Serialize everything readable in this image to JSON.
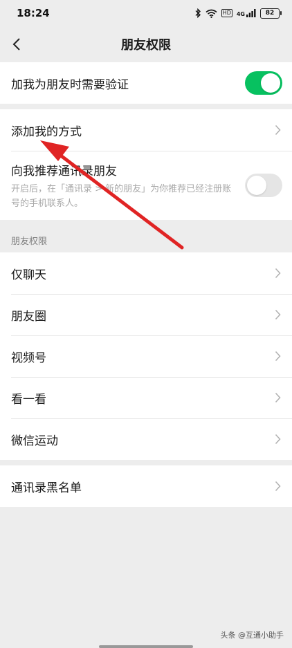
{
  "status_bar": {
    "time": "18:24",
    "network": "4G",
    "hd_label": "HD",
    "battery": "82",
    "icons": [
      "bluetooth-icon",
      "wifi-icon",
      "hd-icon",
      "signal-icon",
      "battery-icon"
    ]
  },
  "header": {
    "title": "朋友权限",
    "back_icon": "chevron-left-icon"
  },
  "verification": {
    "label": "加我为朋友时需要验证",
    "enabled": true
  },
  "add_me": {
    "label": "添加我的方式"
  },
  "recommend": {
    "title": "向我推荐通讯录朋友",
    "description": "开启后，在「通讯录 > 新的朋友」为你推荐已经注册账号的手机联系人。",
    "enabled": false
  },
  "permissions": {
    "section_title": "朋友权限",
    "items": [
      {
        "label": "仅聊天"
      },
      {
        "label": "朋友圈"
      },
      {
        "label": "视频号"
      },
      {
        "label": "看一看"
      },
      {
        "label": "微信运动"
      }
    ]
  },
  "blacklist": {
    "label": "通讯录黑名单"
  },
  "watermark": {
    "text": "头条 @互通小助手"
  },
  "colors": {
    "toggle_on": "#07c160",
    "toggle_off": "#e5e5e5",
    "annotation_arrow": "#e02424",
    "background": "#ededed"
  }
}
